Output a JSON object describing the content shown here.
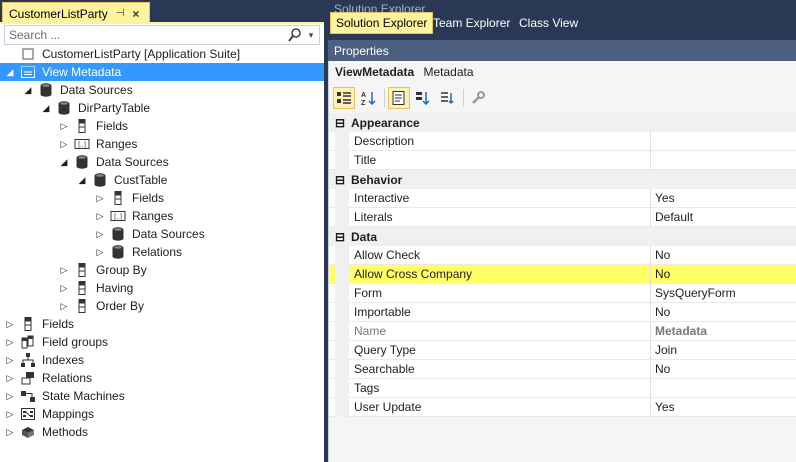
{
  "left_pane": {
    "tab": {
      "title": "CustomerListParty",
      "pin_glyph": "⊣",
      "close_glyph": "×"
    },
    "search": {
      "placeholder": "Search ..."
    },
    "tree": [
      {
        "label": "CustomerListParty [Application Suite]",
        "icon": "project-icon",
        "arrow": "none",
        "depth": 0,
        "selected": false
      },
      {
        "label": "View Metadata",
        "icon": "view-metadata-icon",
        "arrow": "expanded",
        "depth": 0,
        "selected": true
      },
      {
        "label": "Data Sources",
        "icon": "database-icon",
        "arrow": "expanded",
        "depth": 1,
        "selected": false
      },
      {
        "label": "DirPartyTable",
        "icon": "database-icon",
        "arrow": "expanded",
        "depth": 2,
        "selected": false
      },
      {
        "label": "Fields",
        "icon": "fields-icon",
        "arrow": "collapsed",
        "depth": 3,
        "selected": false
      },
      {
        "label": "Ranges",
        "icon": "ranges-icon",
        "arrow": "collapsed",
        "depth": 3,
        "selected": false
      },
      {
        "label": "Data Sources",
        "icon": "database-icon",
        "arrow": "expanded",
        "depth": 3,
        "selected": false
      },
      {
        "label": "CustTable",
        "icon": "database-icon",
        "arrow": "expanded",
        "depth": 4,
        "selected": false
      },
      {
        "label": "Fields",
        "icon": "fields-icon",
        "arrow": "collapsed",
        "depth": 5,
        "selected": false
      },
      {
        "label": "Ranges",
        "icon": "ranges-icon",
        "arrow": "collapsed",
        "depth": 5,
        "selected": false
      },
      {
        "label": "Data Sources",
        "icon": "database-icon",
        "arrow": "collapsed",
        "depth": 5,
        "selected": false
      },
      {
        "label": "Relations",
        "icon": "database-icon",
        "arrow": "collapsed",
        "depth": 5,
        "selected": false
      },
      {
        "label": "Group By",
        "icon": "fields-icon",
        "arrow": "collapsed",
        "depth": 3,
        "selected": false
      },
      {
        "label": "Having",
        "icon": "fields-icon",
        "arrow": "collapsed",
        "depth": 3,
        "selected": false
      },
      {
        "label": "Order By",
        "icon": "fields-icon",
        "arrow": "collapsed",
        "depth": 3,
        "selected": false
      },
      {
        "label": "Fields",
        "icon": "fields-icon",
        "arrow": "collapsed",
        "depth": 0,
        "selected": false
      },
      {
        "label": "Field groups",
        "icon": "field-groups-icon",
        "arrow": "collapsed",
        "depth": 0,
        "selected": false
      },
      {
        "label": "Indexes",
        "icon": "indexes-icon",
        "arrow": "collapsed",
        "depth": 0,
        "selected": false
      },
      {
        "label": "Relations",
        "icon": "relations-icon",
        "arrow": "collapsed",
        "depth": 0,
        "selected": false
      },
      {
        "label": "State Machines",
        "icon": "state-machines-icon",
        "arrow": "collapsed",
        "depth": 0,
        "selected": false
      },
      {
        "label": "Mappings",
        "icon": "mappings-icon",
        "arrow": "collapsed",
        "depth": 0,
        "selected": false
      },
      {
        "label": "Methods",
        "icon": "methods-icon",
        "arrow": "collapsed",
        "depth": 0,
        "selected": false
      }
    ]
  },
  "right_pane": {
    "window_title": "Solution Explorer",
    "tabs": [
      {
        "label": "Solution Explorer",
        "active": true
      },
      {
        "label": "Team Explorer",
        "active": false
      },
      {
        "label": "Class View",
        "active": false
      }
    ],
    "properties": {
      "title": "Properties",
      "object_name": "ViewMetadata",
      "object_type": "Metadata",
      "toolbar": [
        {
          "icon": "categorized-icon",
          "active": true
        },
        {
          "icon": "alphabetical-icon",
          "active": false
        },
        {
          "icon": "separator"
        },
        {
          "icon": "properties-icon",
          "active": true
        },
        {
          "icon": "events-icon",
          "active": false
        },
        {
          "icon": "property-pages-icon",
          "active": false
        },
        {
          "icon": "separator"
        },
        {
          "icon": "wrench-icon",
          "active": false
        }
      ],
      "categories": [
        {
          "name": "Appearance",
          "collapse_glyph": "⊟",
          "rows": [
            {
              "name": "Description",
              "value": ""
            },
            {
              "name": "Title",
              "value": ""
            }
          ]
        },
        {
          "name": "Behavior",
          "collapse_glyph": "⊟",
          "rows": [
            {
              "name": "Interactive",
              "value": "Yes"
            },
            {
              "name": "Literals",
              "value": "Default"
            }
          ]
        },
        {
          "name": "Data",
          "collapse_glyph": "⊟",
          "rows": [
            {
              "name": "Allow Check",
              "value": "No"
            },
            {
              "name": "Allow Cross Company",
              "value": "No",
              "highlight": true
            },
            {
              "name": "Form",
              "value": "SysQueryForm"
            },
            {
              "name": "Importable",
              "value": "No"
            },
            {
              "name": "Name",
              "value": "Metadata",
              "readonly": true
            },
            {
              "name": "Query Type",
              "value": "Join"
            },
            {
              "name": "Searchable",
              "value": "No"
            },
            {
              "name": "Tags",
              "value": ""
            },
            {
              "name": "User Update",
              "value": "Yes"
            }
          ]
        }
      ]
    }
  },
  "colors": {
    "accent_tab": "#fff29d",
    "selection": "#3399ff",
    "highlight_row": "#ffff66",
    "chrome": "#293955"
  }
}
